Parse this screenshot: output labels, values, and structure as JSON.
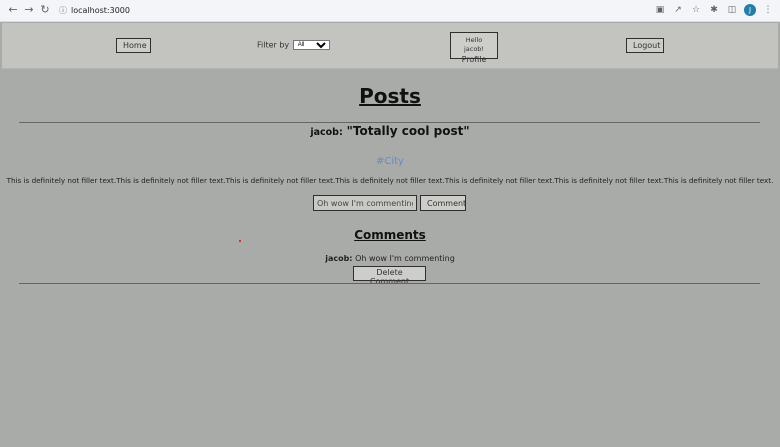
{
  "browser": {
    "url": "localhost:3000",
    "avatar_letter": "J"
  },
  "header": {
    "home_label": "Home",
    "filter_label": "Filter by",
    "filter_selected": "All",
    "profile_greeting": "Hello jacob!",
    "profile_label": "Profile",
    "logout_label": "Logout"
  },
  "page": {
    "title": "Posts"
  },
  "post": {
    "author": "jacob:",
    "title": "\"Totally cool post\"",
    "tag": "#City",
    "body": "This is definitely not filler text.This is definitely not filler text.This is definitely not filler text.This is definitely not filler text.This is definitely not filler text.This is definitely not filler text.This is definitely not filler text.",
    "comment_input_value": "Oh wow I'm commenting",
    "comment_button_label": "Comment"
  },
  "comments": {
    "heading": "Comments",
    "items": [
      {
        "author": "jacob:",
        "text": "Oh wow I'm commenting",
        "delete_label": "Delete Comment"
      }
    ]
  }
}
